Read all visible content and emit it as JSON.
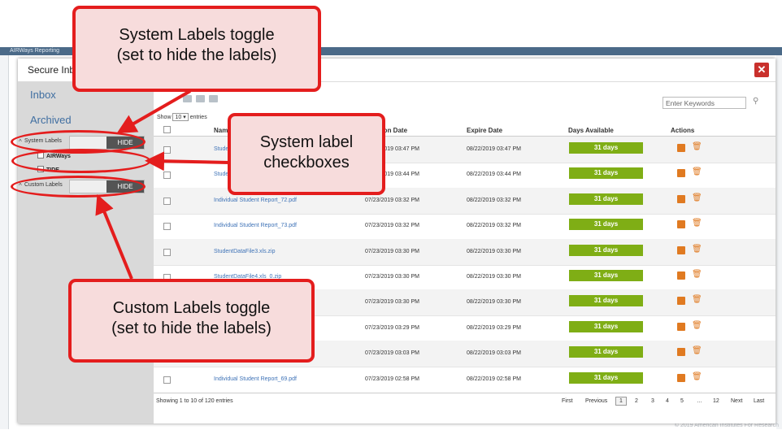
{
  "app": {
    "title": "AIRWays Reporting",
    "copyright": "© 2019 American Institutes For Research"
  },
  "modal": {
    "title": "Secure Inbox",
    "close_icon": "close-icon"
  },
  "sidebar": {
    "nav": [
      "Inbox",
      "Archived"
    ],
    "system_labels": {
      "label": "System Labels",
      "toggle": "HIDE",
      "items": [
        "AIRWays",
        "TIDE"
      ]
    },
    "custom_labels": {
      "label": "Custom Labels",
      "toggle": "HIDE"
    }
  },
  "toolbar": {
    "icons": [
      "unread-icon",
      "archive-icon",
      "delete-icon"
    ],
    "search_placeholder": "Enter Keywords",
    "search_icon": "search-icon"
  },
  "show": {
    "prefix": "Show",
    "value": "10",
    "suffix": "entries"
  },
  "table": {
    "columns": [
      "Name",
      "Creation Date",
      "Expire Date",
      "Days Available",
      "Actions"
    ],
    "rows": [
      {
        "name": "Student Report_70.pdf",
        "created": "07/23/2019 03:47 PM",
        "expires": "08/22/2019 03:47 PM",
        "days": "31 days"
      },
      {
        "name": "Student Report_71.pdf",
        "created": "07/23/2019 03:44 PM",
        "expires": "08/22/2019 03:44 PM",
        "days": "31 days"
      },
      {
        "name": "Individual Student Report_72.pdf",
        "created": "07/23/2019 03:32 PM",
        "expires": "08/22/2019 03:32 PM",
        "days": "31 days"
      },
      {
        "name": "Individual Student Report_73.pdf",
        "created": "07/23/2019 03:32 PM",
        "expires": "08/22/2019 03:32 PM",
        "days": "31 days"
      },
      {
        "name": "StudentDataFile3.xls.zip",
        "created": "07/23/2019 03:30 PM",
        "expires": "08/22/2019 03:30 PM",
        "days": "31 days"
      },
      {
        "name": "StudentDataFile4.xls_0.zip",
        "created": "07/23/2019 03:30 PM",
        "expires": "08/22/2019 03:30 PM",
        "days": "31 days"
      },
      {
        "name": "StudentDataFile5.xls.zip",
        "created": "07/23/2019 03:30 PM",
        "expires": "08/22/2019 03:30 PM",
        "days": "31 days"
      },
      {
        "name": "Individual Student Report_74.pdf",
        "created": "07/23/2019 03:29 PM",
        "expires": "08/22/2019 03:29 PM",
        "days": "31 days"
      },
      {
        "name": "Individual Student Report_75.pdf",
        "created": "07/23/2019 03:03 PM",
        "expires": "08/22/2019 03:03 PM",
        "days": "31 days"
      },
      {
        "name": "Individual Student Report_69.pdf",
        "created": "07/23/2019 02:58 PM",
        "expires": "08/22/2019 02:58 PM",
        "days": "31 days"
      }
    ]
  },
  "footer": {
    "summary": "Showing 1 to 10 of 120 entries",
    "pages": [
      "First",
      "Previous",
      "1",
      "2",
      "3",
      "4",
      "5",
      "…",
      "12",
      "Next",
      "Last"
    ],
    "current_page": "1"
  },
  "callouts": {
    "system_toggle": "System Labels toggle\n(set to hide the labels)",
    "checkboxes": "System label\ncheckboxes",
    "custom_toggle": "Custom Labels toggle\n(set to hide the labels)"
  },
  "colors": {
    "accent": "#7fae15",
    "callout_border": "#e41d1d",
    "callout_fill": "#f7dcdc",
    "action": "#e07a21",
    "link": "#3f73b7"
  }
}
